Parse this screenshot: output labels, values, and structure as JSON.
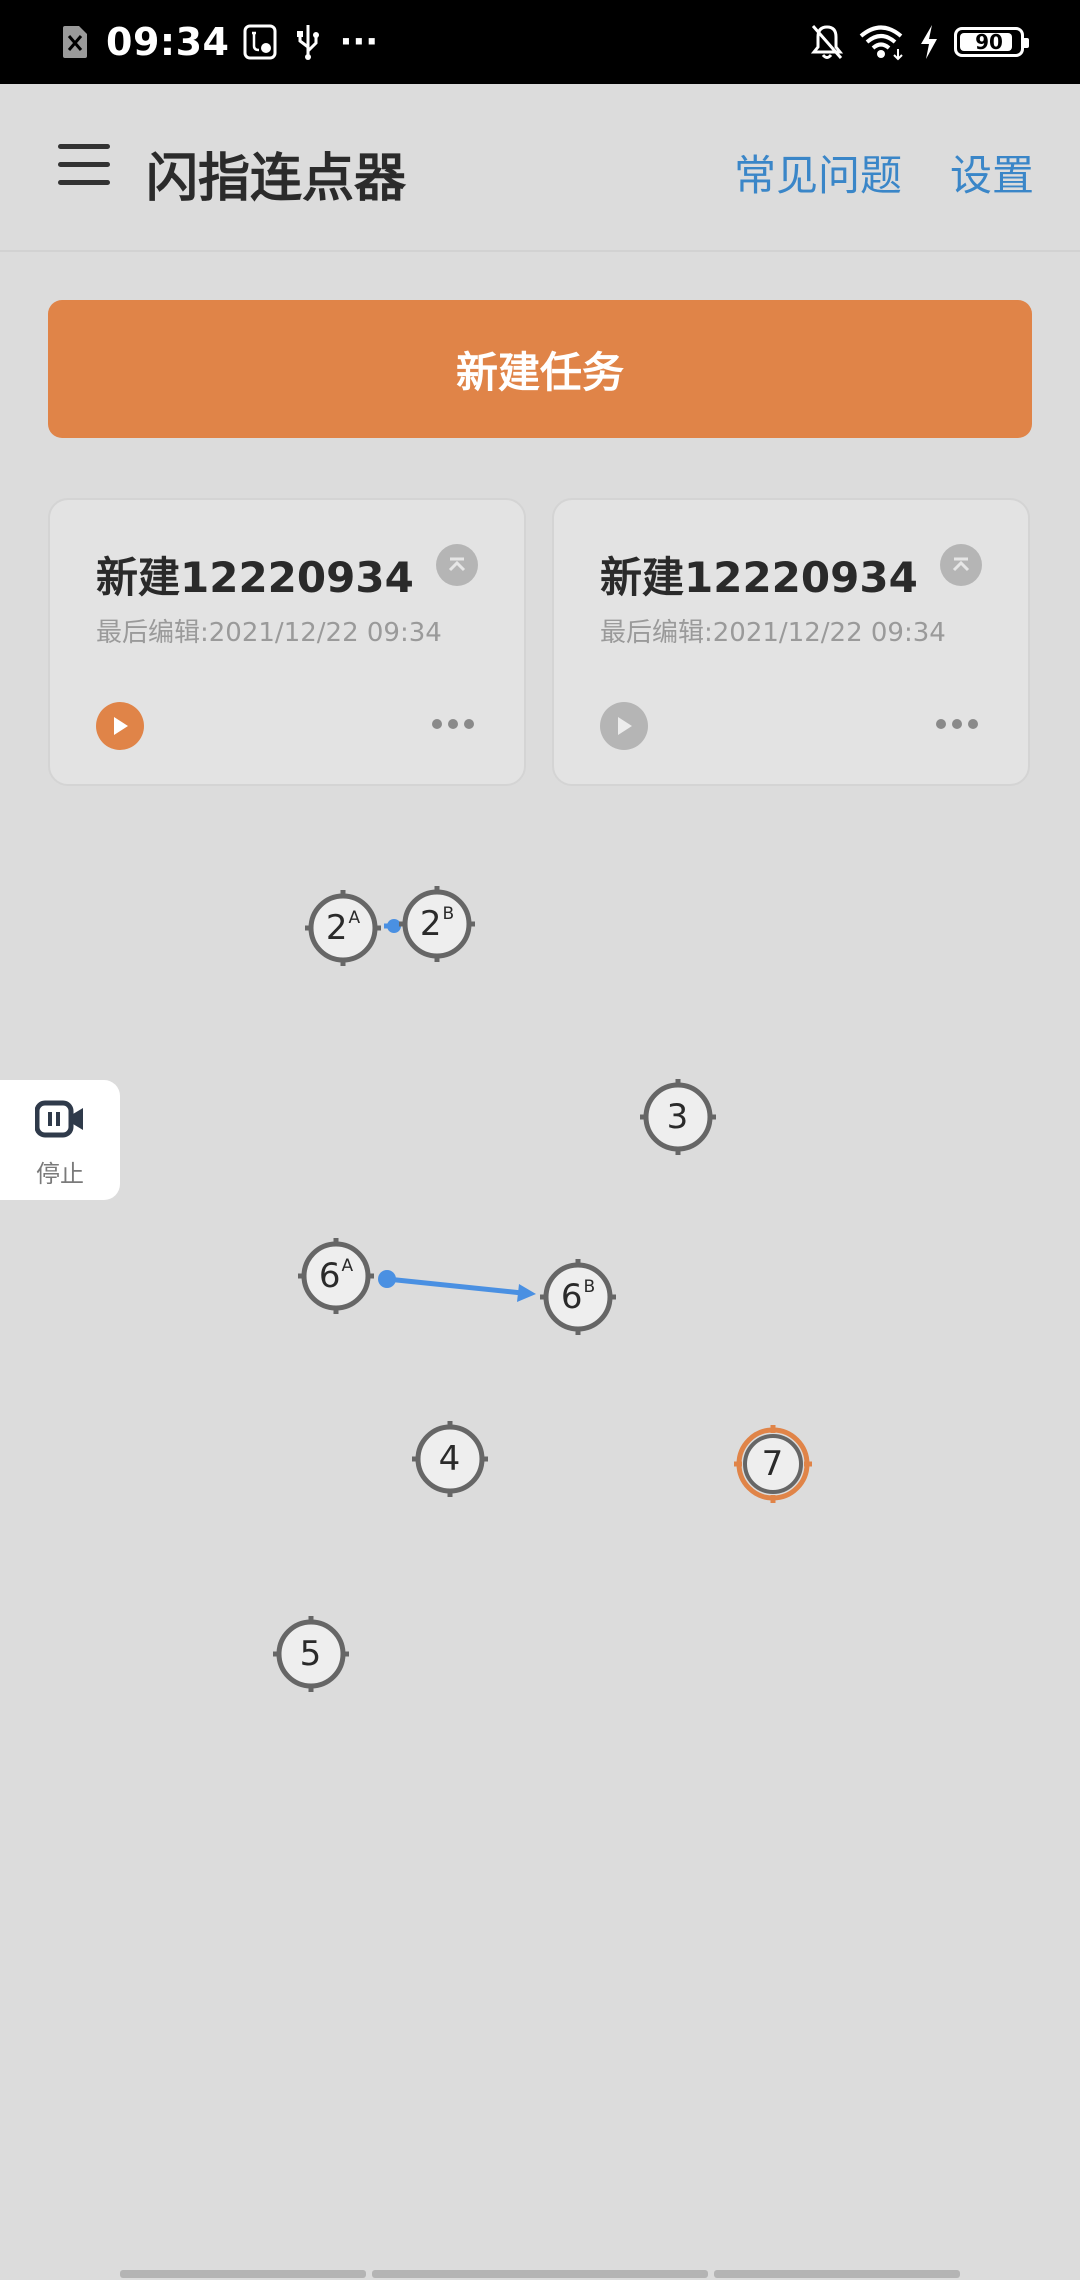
{
  "status_bar": {
    "time": "09:34",
    "more": "···",
    "battery": "90",
    "battery_level": 0.9,
    "icons": [
      "sim-off-icon",
      "usb-debug-icon",
      "usb-icon",
      "bell-off-icon",
      "wifi-icon",
      "charging-icon",
      "battery-icon"
    ]
  },
  "header": {
    "menu_icon": "hamburger-menu-icon",
    "title": "闪指连点器",
    "faq": "常见问题",
    "settings": "设置"
  },
  "new_task_button": "新建任务",
  "tasks": [
    {
      "title": "新建12220934",
      "subtitle": "最后编辑:2021/12/22 09:34",
      "play_state": "active"
    },
    {
      "title": "新建12220934",
      "subtitle": "最后编辑:2021/12/22 09:34",
      "play_state": "inactive"
    }
  ],
  "float_control": {
    "label": "停止",
    "icon": "pause-record-icon"
  },
  "targets": [
    {
      "num": "2",
      "sup": "A"
    },
    {
      "num": "2",
      "sup": "B"
    },
    {
      "num": "3",
      "sup": ""
    },
    {
      "num": "6",
      "sup": "A"
    },
    {
      "num": "6",
      "sup": "B"
    },
    {
      "num": "4",
      "sup": ""
    },
    {
      "num": "7",
      "sup": "",
      "active": true
    },
    {
      "num": "5",
      "sup": ""
    }
  ],
  "colors": {
    "accent": "#e08448",
    "link": "#3a86c8",
    "swipe_line": "#4a90e2",
    "background": "#dcdcdc"
  }
}
